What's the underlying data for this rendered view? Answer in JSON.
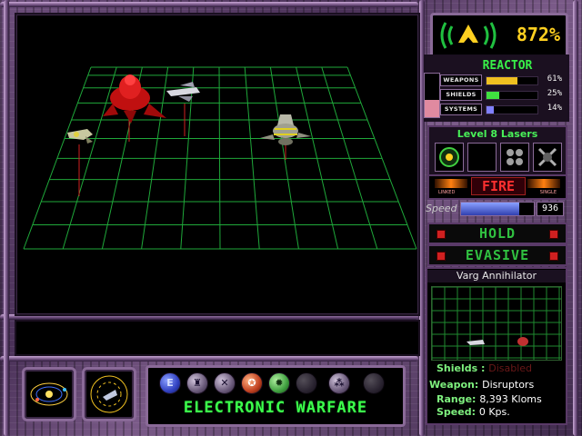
{
  "status": {
    "power_pct": "872%"
  },
  "reactor": {
    "title": "REACTOR",
    "aux_level": 0.4,
    "rows": [
      {
        "label": "WEAPONS",
        "pct": "61%",
        "level": 0.61,
        "color": "#f0c020"
      },
      {
        "label": "SHIELDS",
        "pct": "25%",
        "level": 0.25,
        "color": "#40e040"
      },
      {
        "label": "SYSTEMS",
        "pct": "14%",
        "level": 0.14,
        "color": "#8080ff"
      }
    ]
  },
  "weapon": {
    "title": "Level 8 Lasers",
    "buttons": [
      "target-icon",
      "empty",
      "spread-icon",
      "cross-icon"
    ],
    "fire_label": "FIRE",
    "fire_left": "LINKED",
    "fire_right": "SINGLE"
  },
  "speed": {
    "label": "Speed",
    "value": "936",
    "level": 0.8
  },
  "commands": {
    "hold": "HOLD",
    "evasive": "EVASIVE"
  },
  "target": {
    "name": "Varg Annihilator",
    "shields_label": "Shields :",
    "shields_value": "Disabled",
    "weapon_label": "Weapon:",
    "weapon_value": "Disruptors",
    "range_label": "Range:",
    "range_value": "8,393 Kloms",
    "speed_label": "Speed:",
    "speed_value": "0 Kps."
  },
  "action_bar": {
    "label": "ELECTRONIC WARFARE",
    "icons": [
      "e-icon",
      "lander-icon",
      "x-icon",
      "jam-icon",
      "scan-icon",
      "burst-icon",
      "dashed-icon"
    ]
  },
  "nav": [
    "star-system-icon",
    "ship-view-icon"
  ],
  "colors": {
    "grid": "#1fa83a",
    "frame": "#6d4f7c",
    "hud_green": "#3cff4c",
    "hud_yellow": "#ffd020"
  }
}
